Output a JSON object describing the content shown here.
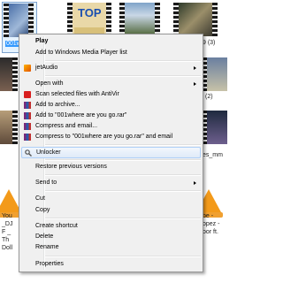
{
  "explorer": {
    "thumbnails": [
      {
        "label": "001w"
      },
      {
        "label": ""
      },
      {
        "label": ""
      },
      {
        "label": "9 (3)"
      },
      {
        "label": ""
      },
      {
        "label": "(2)"
      },
      {
        "label": ""
      },
      {
        "label": "es_mm"
      },
      {
        "label": "You _DJ F _ Th Doll"
      },
      {
        "label": "be - opez - oor ft."
      }
    ]
  },
  "menu": {
    "items": [
      {
        "label": "Play",
        "icon": ""
      },
      {
        "label": "Add to Windows Media Player list",
        "icon": ""
      },
      {
        "label": "jetAudio",
        "icon": "jetaudio-icon"
      },
      {
        "label": "Open with",
        "icon": ""
      },
      {
        "label": "Scan selected files with AntiVir",
        "icon": "antivir-icon"
      },
      {
        "label": "Add to archive...",
        "icon": "winrar-icon"
      },
      {
        "label": "Add to \"001where are you go.rar\"",
        "icon": "winrar-icon"
      },
      {
        "label": "Compress and email...",
        "icon": "winrar-icon"
      },
      {
        "label": "Compress to \"001where are you go.rar\" and email",
        "icon": "winrar-icon"
      },
      {
        "label": "Unlocker",
        "icon": "unlocker-icon"
      },
      {
        "label": "Restore previous versions",
        "icon": ""
      },
      {
        "label": "Send to",
        "icon": ""
      },
      {
        "label": "Cut",
        "icon": ""
      },
      {
        "label": "Copy",
        "icon": ""
      },
      {
        "label": "Create shortcut",
        "icon": ""
      },
      {
        "label": "Delete",
        "icon": ""
      },
      {
        "label": "Rename",
        "icon": ""
      },
      {
        "label": "Properties",
        "icon": ""
      }
    ]
  },
  "colors": {
    "menu_bg": "#f0f0f0",
    "highlight_border": "#aecff7",
    "vlc_orange": "#f39a1a"
  }
}
